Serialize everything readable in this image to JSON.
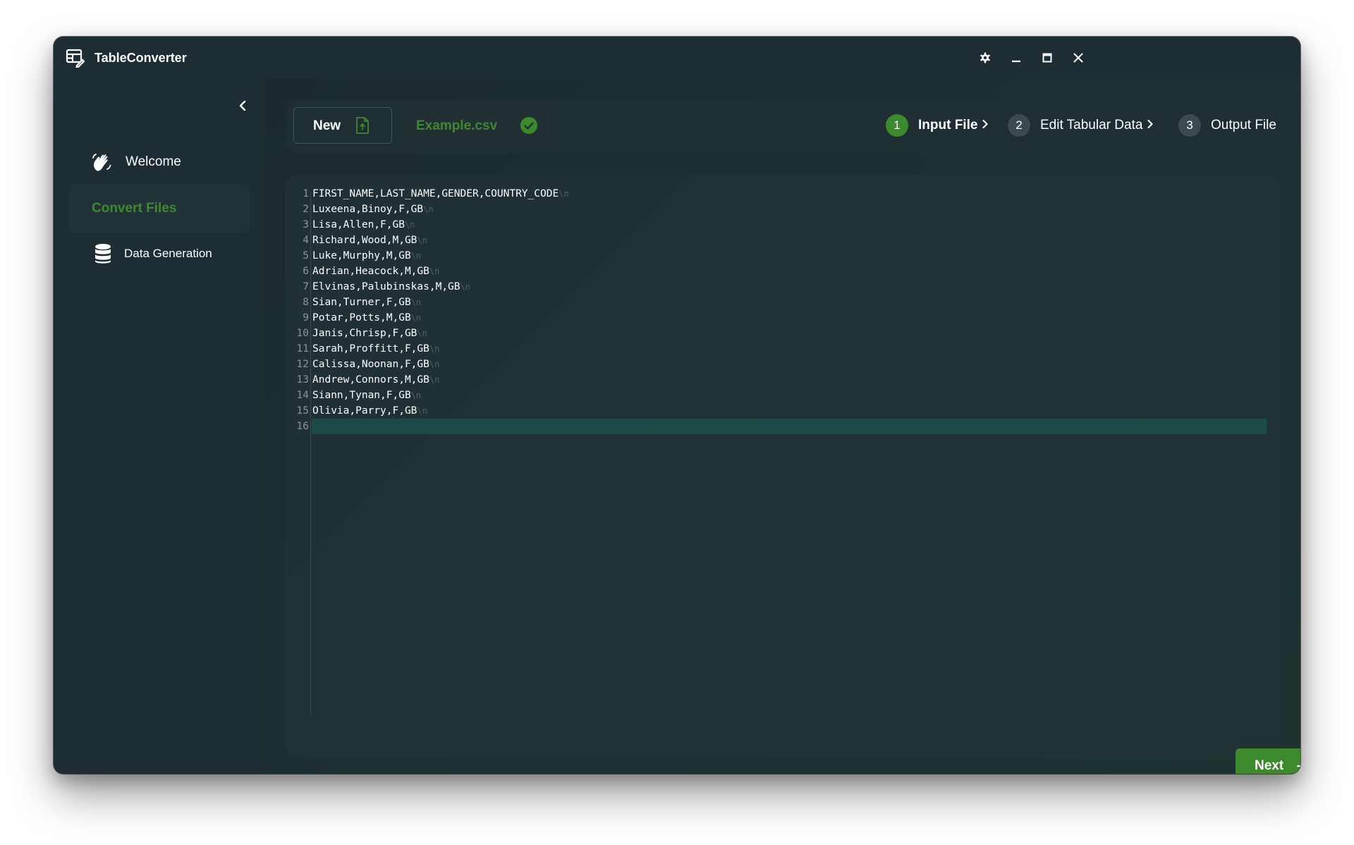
{
  "app": {
    "title": "TableConverter"
  },
  "sidebar": {
    "items": [
      {
        "label": "Welcome",
        "icon": "waving-hand-icon",
        "active": false
      },
      {
        "label": "Convert Files",
        "icon": "",
        "active": true
      },
      {
        "label": "Data Generation",
        "icon": "database-icon",
        "active": false
      }
    ]
  },
  "toolbar": {
    "new_label": "New",
    "file_name": "Example.csv"
  },
  "steps": [
    {
      "num": "1",
      "label": "Input File",
      "active": true
    },
    {
      "num": "2",
      "label": "Edit Tabular Data",
      "active": false
    },
    {
      "num": "3",
      "label": "Output File",
      "active": false
    }
  ],
  "editor": {
    "newline_marker": "\\n",
    "lines": [
      {
        "num": "1",
        "text": "FIRST_NAME,LAST_NAME,GENDER,COUNTRY_CODE"
      },
      {
        "num": "2",
        "text": "Luxeena,Binoy,F,GB"
      },
      {
        "num": "3",
        "text": "Lisa,Allen,F,GB"
      },
      {
        "num": "4",
        "text": "Richard,Wood,M,GB"
      },
      {
        "num": "5",
        "text": "Luke,Murphy,M,GB"
      },
      {
        "num": "6",
        "text": "Adrian,Heacock,M,GB"
      },
      {
        "num": "7",
        "text": "Elvinas,Palubinskas,M,GB"
      },
      {
        "num": "8",
        "text": "Sian,Turner,F,GB"
      },
      {
        "num": "9",
        "text": "Potar,Potts,M,GB"
      },
      {
        "num": "10",
        "text": "Janis,Chrisp,F,GB"
      },
      {
        "num": "11",
        "text": "Sarah,Proffitt,F,GB"
      },
      {
        "num": "12",
        "text": "Calissa,Noonan,F,GB"
      },
      {
        "num": "13",
        "text": "Andrew,Connors,M,GB"
      },
      {
        "num": "14",
        "text": "Siann,Tynan,F,GB"
      },
      {
        "num": "15",
        "text": "Olivia,Parry,F,GB"
      },
      {
        "num": "16",
        "text": ""
      }
    ],
    "current_line": 16
  },
  "footer": {
    "next_label": "Next"
  },
  "colors": {
    "accent": "#3d8a2e",
    "window_bg": "#1c2b30",
    "current_line_bg": "#1c4a47"
  }
}
